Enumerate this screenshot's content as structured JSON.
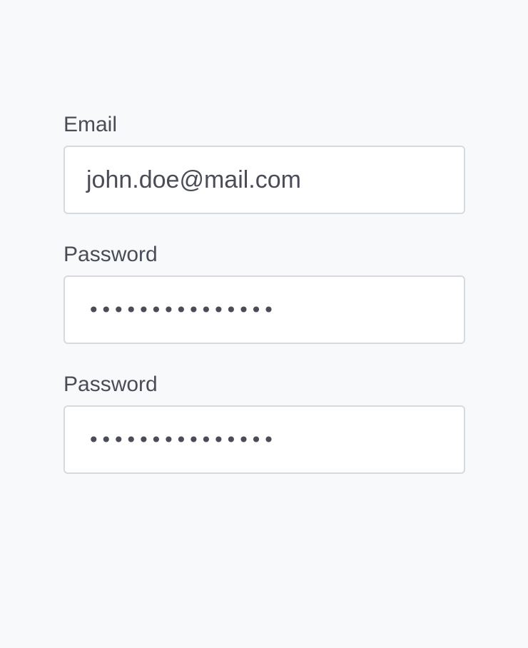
{
  "form": {
    "fields": [
      {
        "label": "Email",
        "value": "john.doe@mail.com"
      },
      {
        "label": "Password",
        "value": "•••••••••••••••"
      },
      {
        "label": "Password",
        "value": "•••••••••••••••"
      }
    ]
  },
  "colors": {
    "page_background": "#f8f9fb",
    "label_text": "#4a4d57",
    "input_border": "#d6dadf",
    "input_background": "#ffffff"
  }
}
